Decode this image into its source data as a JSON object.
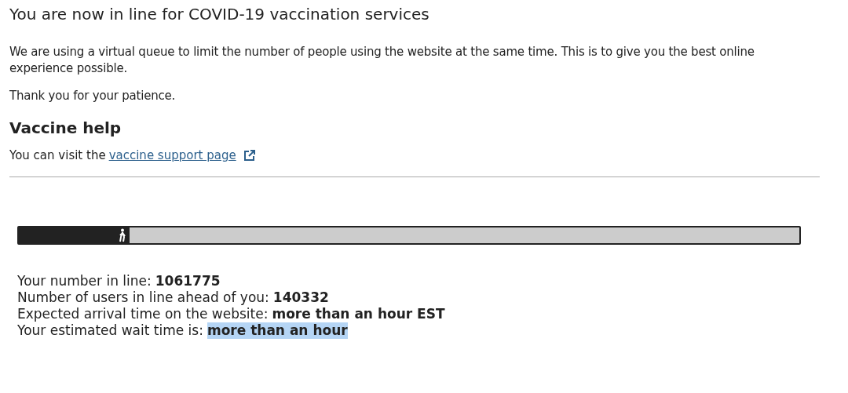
{
  "title": "You are now in line for COVID-19 vaccination services",
  "paragraphs": [
    "We are using a virtual queue to limit the number of people using the website at the same time. This is to give you the best online experience possible.",
    "Thank you for your patience."
  ],
  "help": {
    "heading": "Vaccine help",
    "text": "You can visit the",
    "link": "vaccine support page"
  },
  "queue": {
    "level": 0.142
  },
  "stats": [
    {
      "label": "Your number in line:",
      "value": "1061775",
      "highlighted": false
    },
    {
      "label": "Number of users in line ahead of you:",
      "value": "140332",
      "highlighted": false
    },
    {
      "label": "Expected arrival time on the website:",
      "value": "more than an hour EST",
      "highlighted": false
    },
    {
      "label": "Your estimated wait time is:",
      "value": "more than an hour",
      "highlighted": true
    }
  ]
}
